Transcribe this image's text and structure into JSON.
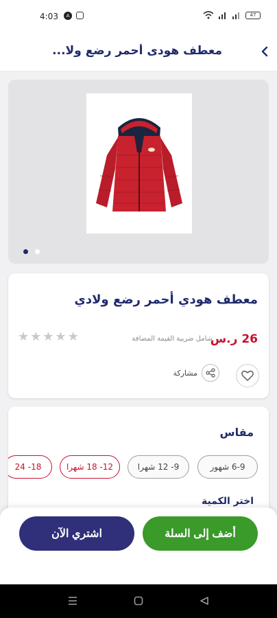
{
  "status_bar": {
    "time": "4:03",
    "battery": "47"
  },
  "header": {
    "title": "معطف هودى أحمر رضع ولا...",
    "back_icon": "chevron-left-icon"
  },
  "gallery": {
    "image_count": 2,
    "active_index": 0,
    "jacket_color": "#c8222e"
  },
  "product": {
    "name": "معطف هودي أحمر رضع ولادي",
    "price": "26 ر.س",
    "vat_note": "شامل ضريبة القيمة المضافة",
    "rating": {
      "value": 0,
      "max": 5
    },
    "share_label": "مشاركة"
  },
  "sizes": {
    "title": "مقاس",
    "options": [
      {
        "label": "6-9 شهور",
        "available": true
      },
      {
        "label": "9- 12 شهرا",
        "available": true
      },
      {
        "label": "12- 18 شهرا",
        "available": false
      },
      {
        "label": "18- 24",
        "available": false
      }
    ],
    "quantity_title": "اختر الكمية"
  },
  "actions": {
    "add_to_cart": "أضف إلى السلة",
    "buy_now": "اشتري الآن"
  },
  "colors": {
    "primary": "#1f2a6b",
    "green": "#3a9a2a",
    "purple": "#2f2f7a",
    "price_red": "#c8102e"
  }
}
